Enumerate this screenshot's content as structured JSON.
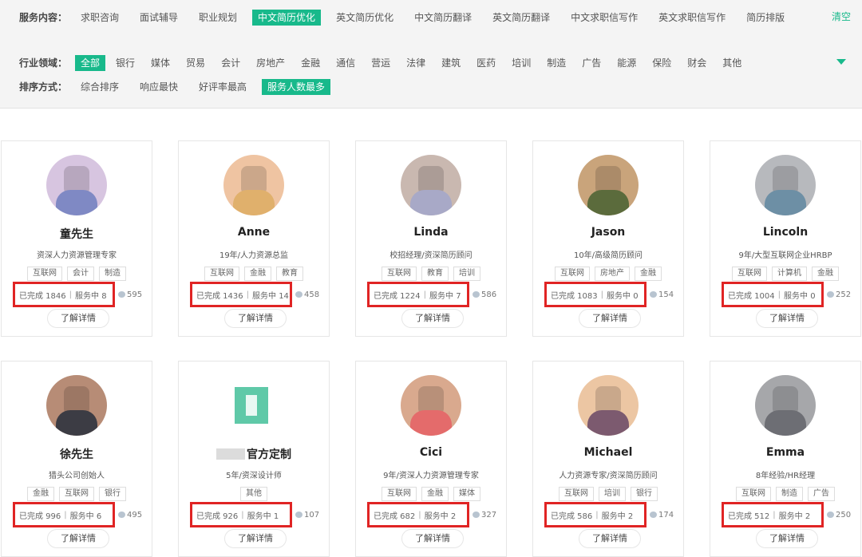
{
  "filters": {
    "service": {
      "label": "服务内容：",
      "options": [
        "求职咨询",
        "面试辅导",
        "职业规划",
        "中文简历优化",
        "英文简历优化",
        "中文简历翻译",
        "英文简历翻译",
        "中文求职信写作",
        "英文求职信写作",
        "简历排版"
      ],
      "active_index": 3
    },
    "industry": {
      "label": "行业领域：",
      "options": [
        "全部",
        "银行",
        "媒体",
        "贸易",
        "会计",
        "房地产",
        "金融",
        "通信",
        "营运",
        "法律",
        "建筑",
        "医药",
        "培训",
        "制造",
        "广告",
        "能源",
        "保险",
        "财会",
        "其他"
      ],
      "active_index": 0
    },
    "sort": {
      "label": "排序方式：",
      "options": [
        "综合排序",
        "响应最快",
        "好评率最高",
        "服务人数最多"
      ],
      "active_index": 3
    },
    "clear_label": "清空"
  },
  "consultants": [
    {
      "name": "童先生",
      "title": "资深人力资源管理专家",
      "tags": [
        "互联网",
        "会计",
        "制造"
      ],
      "completed_label": "已完成 1846",
      "serving_label": "服务中 8",
      "comments": "595",
      "avatar_colors": [
        "#d7c5e0",
        "#7f89c4"
      ]
    },
    {
      "name": "Anne",
      "title": "19年/人力资源总监",
      "tags": [
        "互联网",
        "金融",
        "教育"
      ],
      "completed_label": "已完成 1436",
      "serving_label": "服务中 14",
      "comments": "458",
      "avatar_colors": [
        "#efc4a2",
        "#e0b06c"
      ]
    },
    {
      "name": "Linda",
      "title": "校招经理/资深简历顾问",
      "tags": [
        "互联网",
        "教育",
        "培训"
      ],
      "completed_label": "已完成 1224",
      "serving_label": "服务中 7",
      "comments": "586",
      "avatar_colors": [
        "#c9b8b0",
        "#a8a9c7"
      ]
    },
    {
      "name": "Jason",
      "title": "10年/高级简历顾问",
      "tags": [
        "互联网",
        "房地产",
        "金融"
      ],
      "completed_label": "已完成 1083",
      "serving_label": "服务中 0",
      "comments": "154",
      "avatar_colors": [
        "#c9a47b",
        "#5b6b3c"
      ]
    },
    {
      "name": "Lincoln",
      "title": "9年/大型互联网企业HRBP",
      "tags": [
        "互联网",
        "计算机",
        "金融"
      ],
      "completed_label": "已完成 1004",
      "serving_label": "服务中 0",
      "comments": "252",
      "avatar_colors": [
        "#b7b9bd",
        "#6d8fa5"
      ]
    },
    {
      "name": "徐先生",
      "title": "猎头公司创始人",
      "tags": [
        "金融",
        "互联网",
        "银行"
      ],
      "completed_label": "已完成 996",
      "serving_label": "服务中 6",
      "comments": "495",
      "avatar_colors": [
        "#b78c76",
        "#3c3c44"
      ]
    },
    {
      "name": "官方定制",
      "title": "5年/资深设计师",
      "tags": [
        "其他"
      ],
      "completed_label": "已完成 926",
      "serving_label": "服务中 1",
      "comments": "107",
      "avatar_colors": [
        "#5fc9a8",
        "#e9f8f3"
      ],
      "is_logo": true
    },
    {
      "name": "Cici",
      "title": "9年/资深人力资源管理专家",
      "tags": [
        "互联网",
        "金融",
        "媒体"
      ],
      "completed_label": "已完成 682",
      "serving_label": "服务中 2",
      "comments": "327",
      "avatar_colors": [
        "#d9a98e",
        "#e46b6b"
      ]
    },
    {
      "name": "Michael",
      "title": "人力资源专家/资深简历顾问",
      "tags": [
        "互联网",
        "培训",
        "银行"
      ],
      "completed_label": "已完成 586",
      "serving_label": "服务中 2",
      "comments": "174",
      "avatar_colors": [
        "#ecc6a3",
        "#7c5a6f"
      ]
    },
    {
      "name": "Emma",
      "title": "8年经验/HR经理",
      "tags": [
        "互联网",
        "制造",
        "广告"
      ],
      "completed_label": "已完成 512",
      "serving_label": "服务中 2",
      "comments": "250",
      "avatar_colors": [
        "#a6a7aa",
        "#6d6e74"
      ]
    }
  ],
  "detail_label": "了解详情"
}
